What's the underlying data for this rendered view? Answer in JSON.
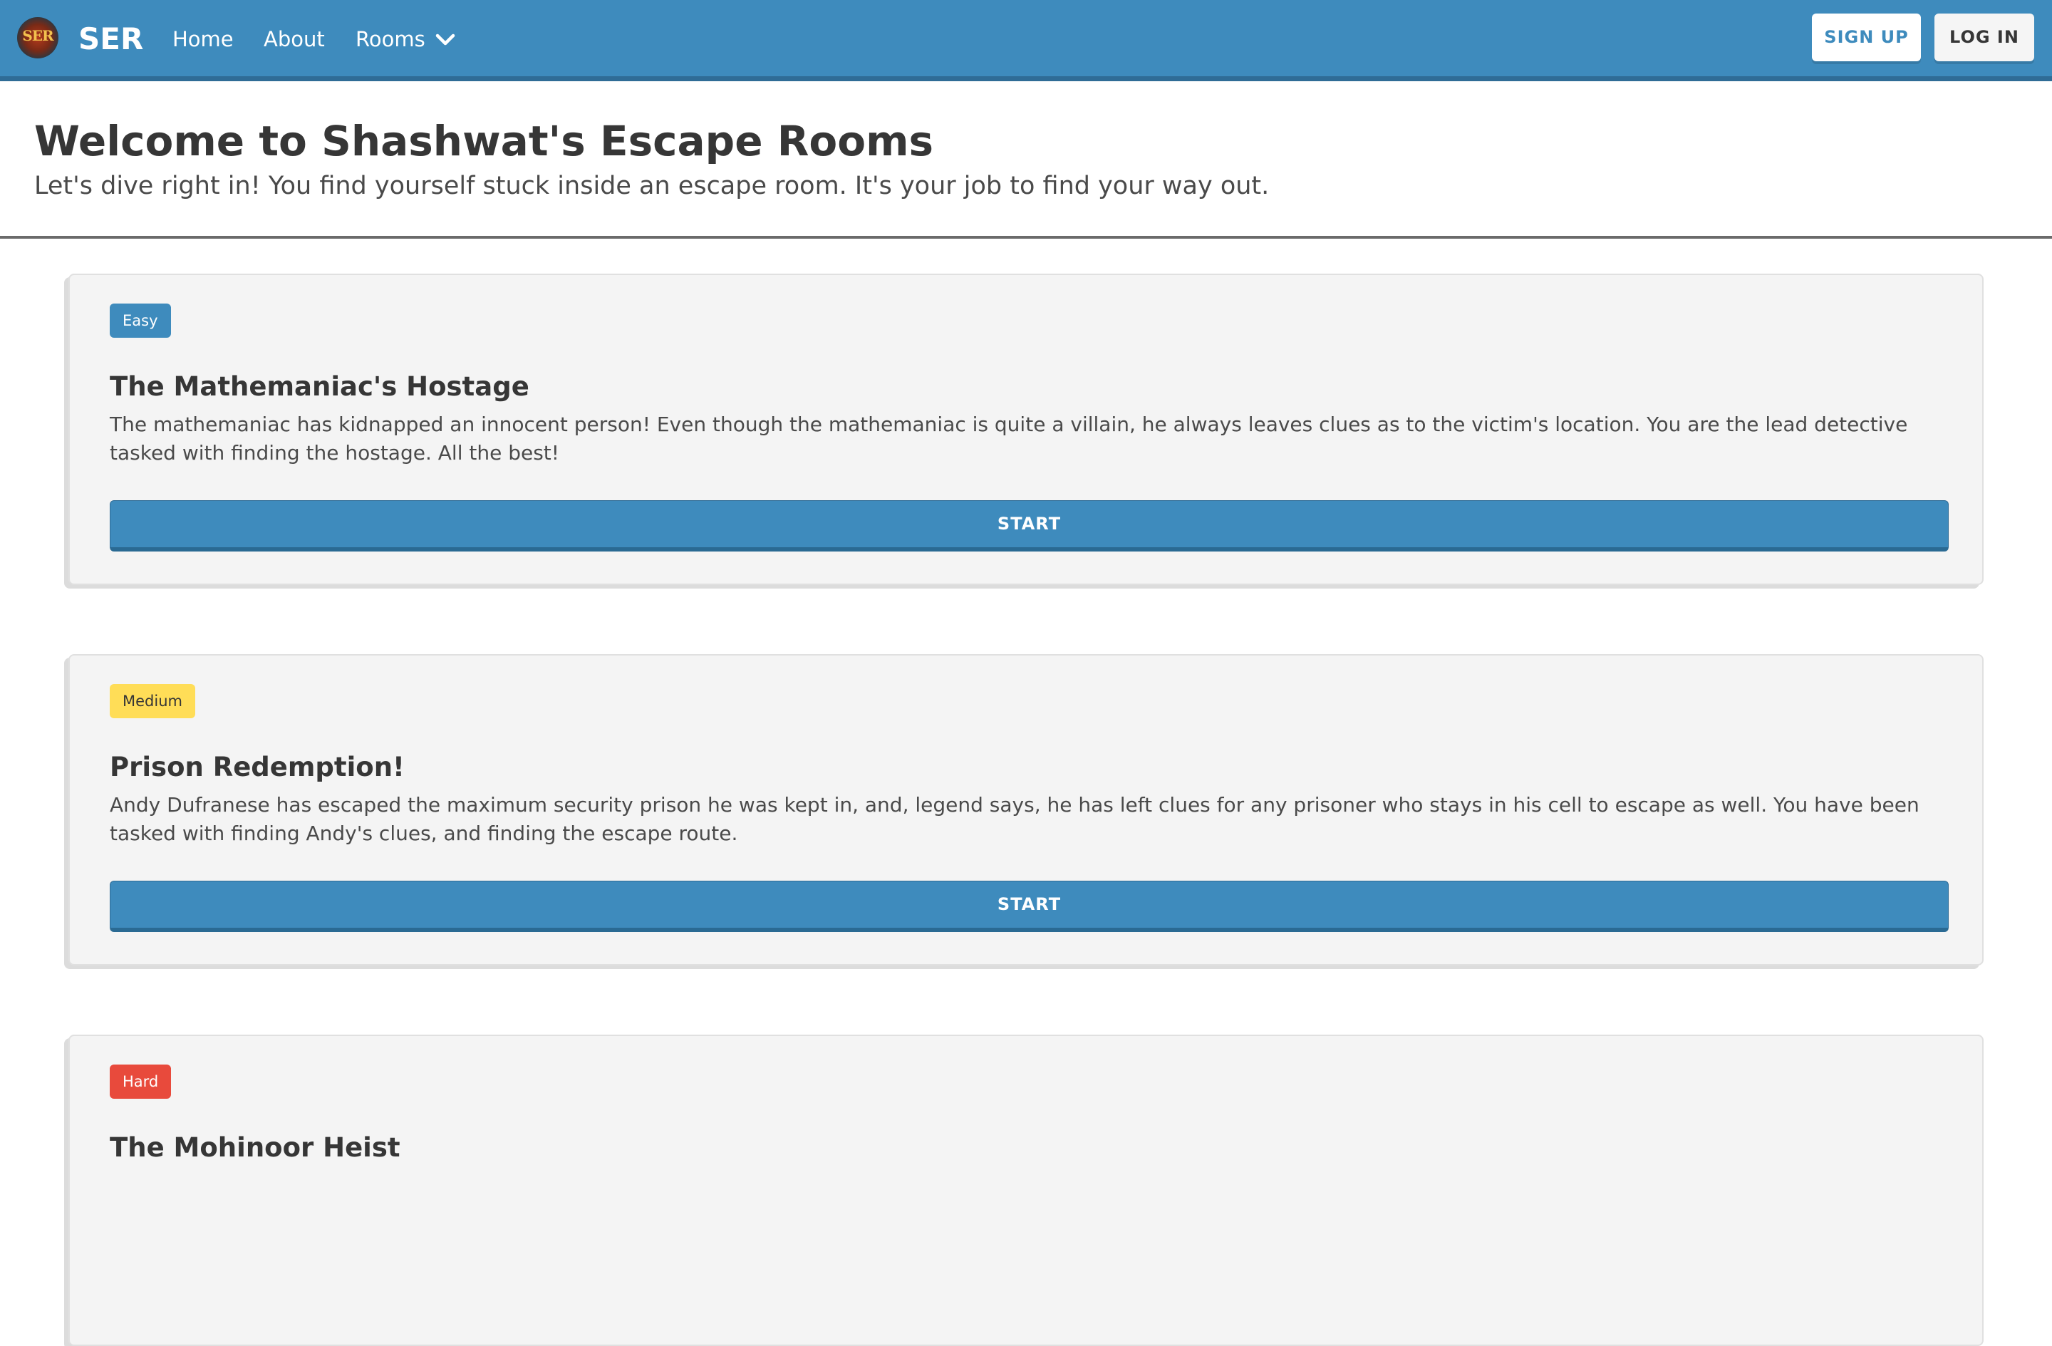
{
  "navbar": {
    "logo_text": "SER",
    "brand": "SER",
    "links": {
      "home": "Home",
      "about": "About",
      "rooms": "Rooms"
    },
    "signup_label": "SIGN UP",
    "login_label": "LOG IN",
    "colors": {
      "primary": "#3e8bbd",
      "primary_dark": "#2f6c96"
    }
  },
  "hero": {
    "title": "Welcome to Shashwat's Escape Rooms",
    "subtitle": "Let's dive right in! You find yourself stuck inside an escape room. It's your job to find your way out."
  },
  "rooms": [
    {
      "difficulty": "Easy",
      "difficulty_color": "#3e8bbd",
      "title": "The Mathemaniac's Hostage",
      "description": "The mathemaniac has kidnapped an innocent person! Even though the mathemaniac is quite a villain, he always leaves clues as to the victim's location. You are the lead detective tasked with finding the hostage. All the best!",
      "start_label": "START"
    },
    {
      "difficulty": "Medium",
      "difficulty_color": "#ffdd57",
      "title": "Prison Redemption!",
      "description": "Andy Dufranese has escaped the maximum security prison he was kept in, and, legend says, he has left clues for any prisoner who stays in his cell to escape as well. You have been tasked with finding Andy's clues, and finding the escape route.",
      "start_label": "START"
    },
    {
      "difficulty": "Hard",
      "difficulty_color": "#e84a3c",
      "title": "The Mohinoor Heist"
    }
  ]
}
